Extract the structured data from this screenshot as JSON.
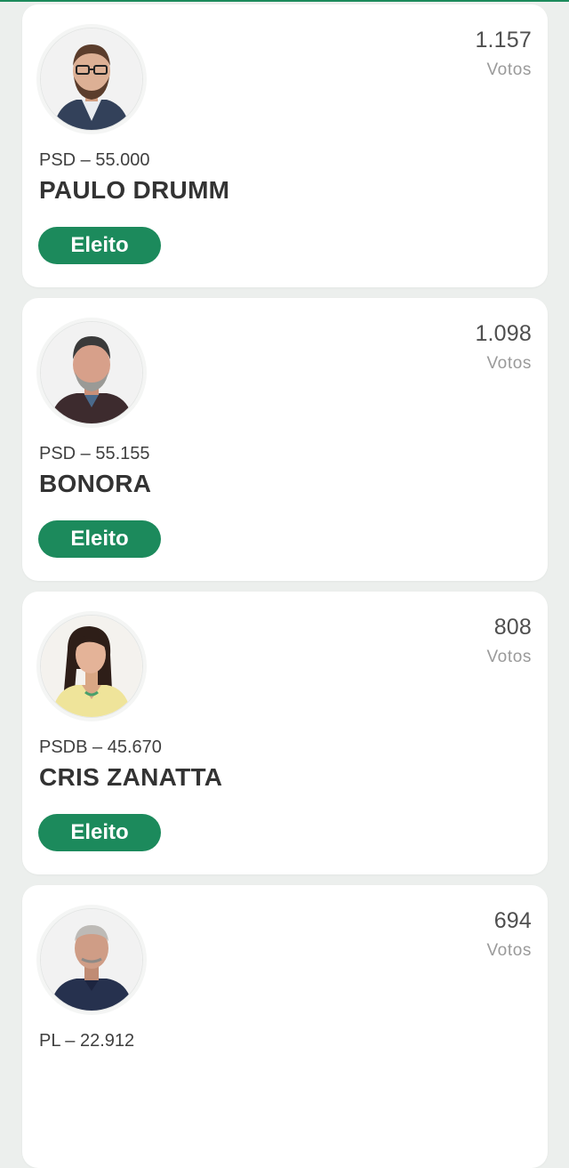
{
  "colors": {
    "accent": "#1c8a5c",
    "page_background": "#ecefed",
    "card_background": "#ffffff"
  },
  "candidates": [
    {
      "party_number": "PSD – 55.000",
      "name": "PAULO DRUMM",
      "votes": "1.157",
      "votes_label": "Votos",
      "status": "Eleito",
      "photo_icon": "candidate-photo-man-glasses-beard"
    },
    {
      "party_number": "PSD – 55.155",
      "name": "BONORA",
      "votes": "1.098",
      "votes_label": "Votos",
      "status": "Eleito",
      "photo_icon": "candidate-photo-man-gray-beard"
    },
    {
      "party_number": "PSDB – 45.670",
      "name": "CRIS ZANATTA",
      "votes": "808",
      "votes_label": "Votos",
      "status": "Eleito",
      "photo_icon": "candidate-photo-woman-yellow-blouse"
    },
    {
      "party_number": "PL – 22.912",
      "votes": "694",
      "votes_label": "Votos",
      "photo_icon": "candidate-photo-older-man-navy-shirt"
    }
  ]
}
